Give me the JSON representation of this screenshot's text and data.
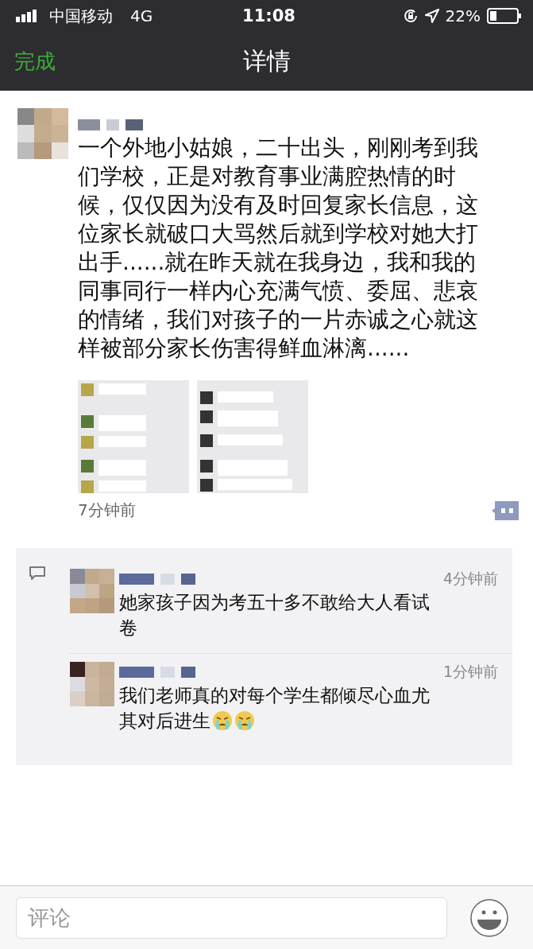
{
  "status_bar": {
    "carrier": "中国移动",
    "network": "4G",
    "time": "11:08",
    "battery": "22%"
  },
  "nav": {
    "back": "完成",
    "title": "详情"
  },
  "post": {
    "text": "一个外地小姑娘，二十出头，刚刚考到我们学校，正是对教育事业满腔热情的时候，仅仅因为没有及时回复家长信息，这位家长就破口大骂然后就到学校对她大打出手......就在昨天就在我身边，我和我的同事同行一样内心充满气愤、委屈、悲哀的情绪，我们对孩子的一片赤诚之心就这样被部分家长伤害得鲜血淋漓......",
    "time": "7分钟前"
  },
  "comments": [
    {
      "time": "4分钟前",
      "text": "她家孩子因为考五十多不敢给大人看试卷"
    },
    {
      "time": "1分钟前",
      "text": "我们老师真的对每个学生都倾尽心血尤其对后进生",
      "emojis": [
        {
          "kind": "crying"
        },
        {
          "kind": "crying"
        }
      ]
    }
  ],
  "comment_bar": {
    "placeholder": "评论"
  }
}
